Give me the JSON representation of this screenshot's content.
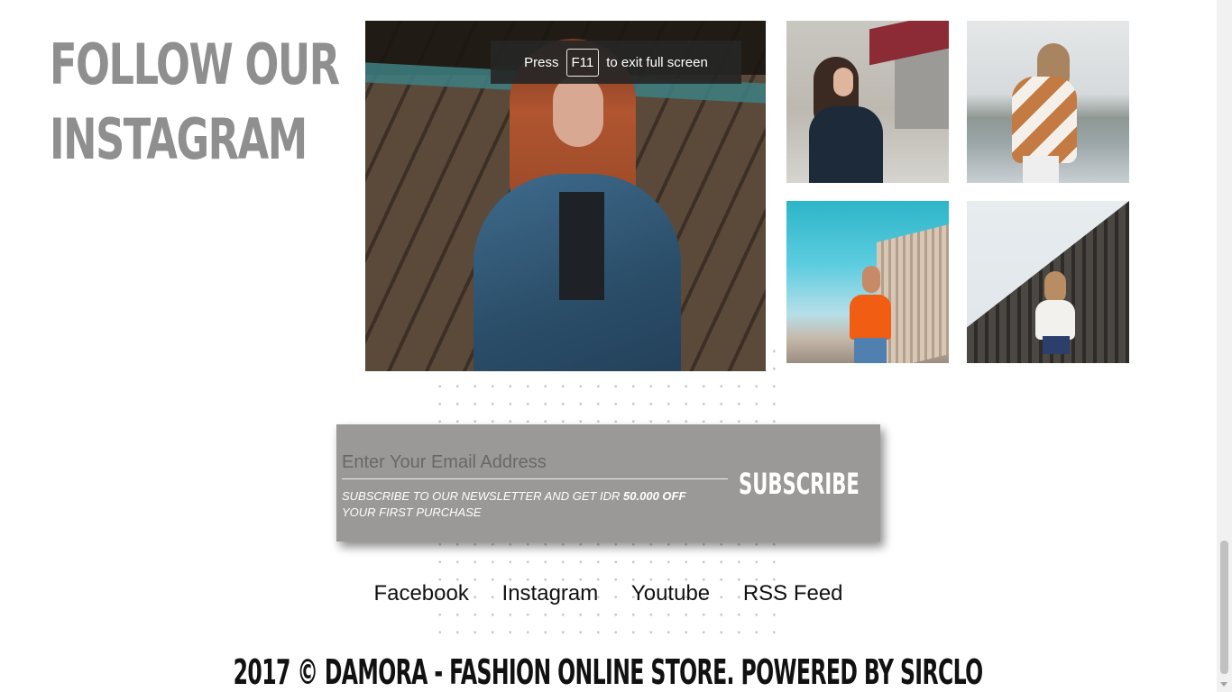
{
  "instagram": {
    "title_line1": "FOLLOW OUR",
    "title_line2": "INSTAGRAM"
  },
  "fullscreen_toast": {
    "prefix": "Press",
    "key": "F11",
    "suffix": "to exit full screen"
  },
  "newsletter": {
    "email_placeholder": "Enter Your Email Address",
    "note_part1": "SUBSCRIBE TO OUR NEWSLETTER AND GET IDR ",
    "note_bold": "50.000 OFF",
    "note_part2": " YOUR FIRST PURCHASE",
    "subscribe_label": "SUBSCRIBE"
  },
  "social_links": [
    "Facebook",
    "Instagram",
    "Youtube",
    "RSS Feed"
  ],
  "footer": {
    "copyright": "2017 © DAMORA - FASHION ONLINE STORE. POWERED BY SIRCLO"
  }
}
